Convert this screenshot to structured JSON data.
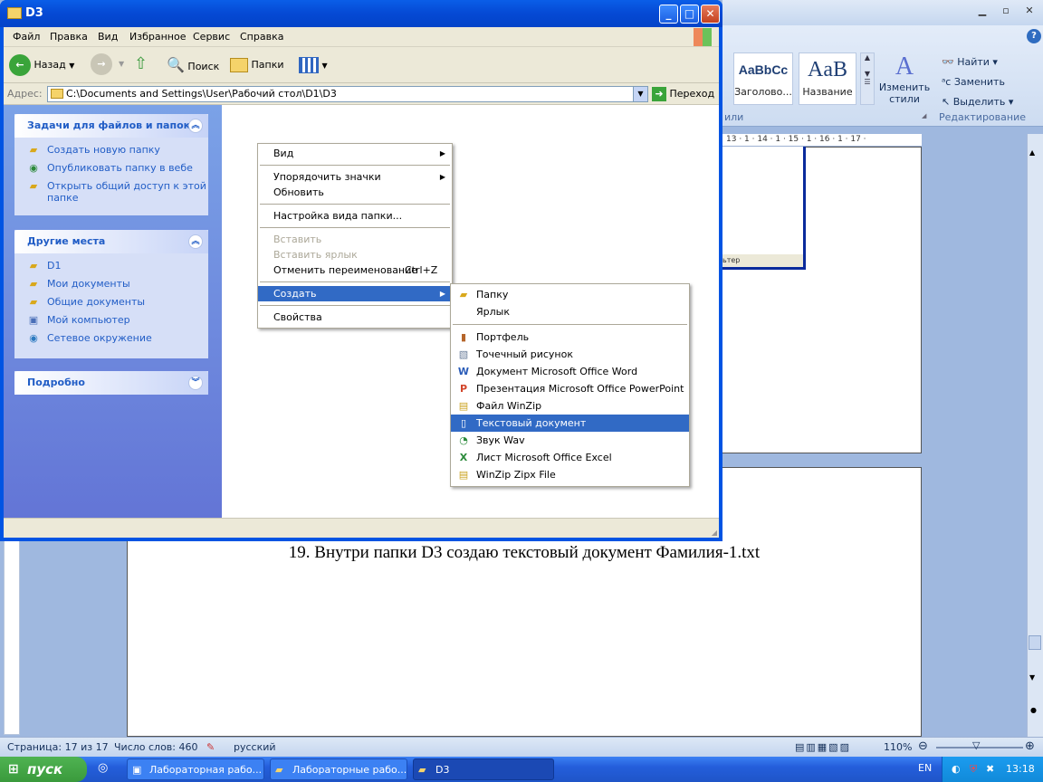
{
  "word": {
    "styles": [
      {
        "preview": "AaBbCc",
        "label": "Заголово..."
      },
      {
        "preview": "AaB",
        "label": "Название"
      }
    ],
    "change_styles": "Изменить стили",
    "editing": {
      "find": "Найти",
      "replace": "Заменить",
      "select": "Выделить"
    },
    "group_styles_tail": "или",
    "group_editing": "Редактирование",
    "ruler_text": "13 · 1 · 14 · 1 · 15 · 1 · 16 · 1 · 17 ·",
    "inner_window_tail": "ьтер",
    "caption": "19. Внутри папки D3 создаю текстовый документ Фамилия-1.txt",
    "status": {
      "page": "Страница: 17 из 17",
      "words": "Число слов: 460",
      "language": "русский",
      "zoom": "110%"
    }
  },
  "taskbar": {
    "start": "пуск",
    "buttons": [
      "Лабораторная рабо...",
      "Лабораторные рабо...",
      "D3"
    ],
    "lang": "EN",
    "time": "13:18"
  },
  "explorer": {
    "title": "D3",
    "menu": [
      "Файл",
      "Правка",
      "Вид",
      "Избранное",
      "Сервис",
      "Справка"
    ],
    "toolbar": {
      "back": "Назад",
      "search": "Поиск",
      "folders": "Папки"
    },
    "address_label": "Адрес:",
    "address": "C:\\Documents and Settings\\User\\Рабочий стол\\D1\\D3",
    "go": "Переход",
    "tasks_panel": {
      "title": "Задачи для файлов и папок",
      "items": [
        "Создать новую папку",
        "Опубликовать папку в вебе",
        "Открыть общий доступ к этой папке"
      ]
    },
    "places_panel": {
      "title": "Другие места",
      "items": [
        "D1",
        "Мои документы",
        "Общие документы",
        "Мой компьютер",
        "Сетевое окружение"
      ]
    },
    "details_panel": {
      "title": "Подробно"
    }
  },
  "context_menu": {
    "view": "Вид",
    "arrange": "Упорядочить значки",
    "refresh": "Обновить",
    "customize": "Настройка вида папки...",
    "paste": "Вставить",
    "paste_shortcut": "Вставить ярлык",
    "undo_rename": "Отменить переименование",
    "undo_shortcut": "Ctrl+Z",
    "new": "Создать",
    "properties": "Свойства"
  },
  "new_submenu": {
    "folder": "Папку",
    "shortcut": "Ярлык",
    "items": [
      {
        "label": "Портфель",
        "icon": "briefcase-icon"
      },
      {
        "label": "Точечный рисунок",
        "icon": "bitmap-icon"
      },
      {
        "label": "Документ Microsoft Office Word",
        "icon": "word-icon"
      },
      {
        "label": "Презентация Microsoft Office PowerPoint",
        "icon": "powerpoint-icon"
      },
      {
        "label": "Файл WinZip",
        "icon": "winzip-icon"
      },
      {
        "label": "Текстовый документ",
        "icon": "text-document-icon"
      },
      {
        "label": "Звук Wav",
        "icon": "wave-sound-icon"
      },
      {
        "label": "Лист Microsoft Office Excel",
        "icon": "excel-icon"
      },
      {
        "label": "WinZip Zipx File",
        "icon": "winzip-zipx-icon"
      }
    ]
  }
}
